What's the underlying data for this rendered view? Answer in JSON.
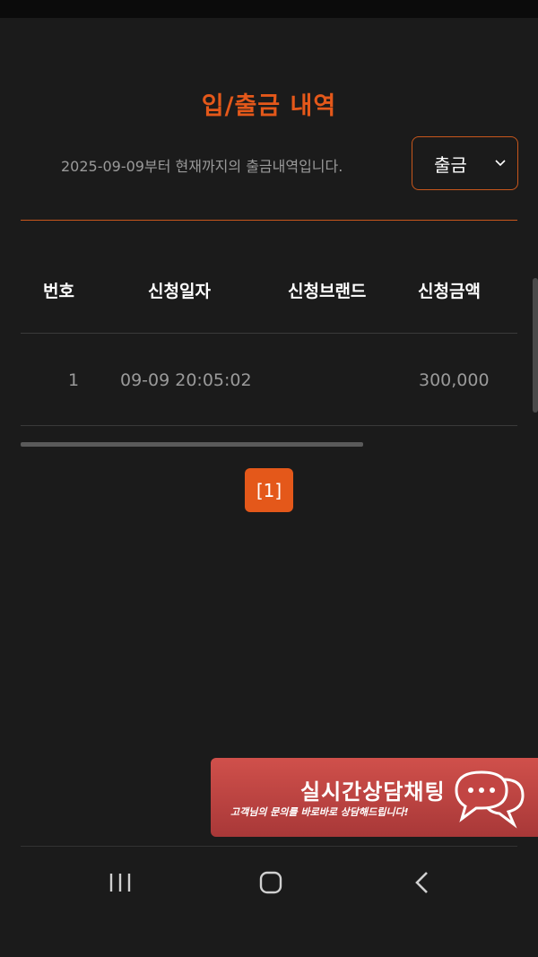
{
  "page": {
    "title": "입/출금 내역",
    "description": "2025-09-09부터 현재까지의 출금내역입니다."
  },
  "filter": {
    "selected": "출금"
  },
  "table": {
    "headers": [
      "번호",
      "신청일자",
      "신청브랜드",
      "신청금액"
    ],
    "rows": [
      {
        "no": "1",
        "date": "09-09 20:05:02",
        "brand": "",
        "amount": "300,000"
      }
    ]
  },
  "pagination": {
    "current_label": "[1]"
  },
  "chat_banner": {
    "title": "실시간상담채팅",
    "subtitle": "고객님의 문의를 바로바로 상담해드립니다!",
    "icon": "chat-bubble-icon"
  },
  "navbar": {
    "recent_icon": "recent-apps-icon",
    "home_icon": "home-icon",
    "back_icon": "back-icon"
  },
  "colors": {
    "accent": "#e4581a",
    "background": "#1b1b1b",
    "banner": "#c24543"
  }
}
